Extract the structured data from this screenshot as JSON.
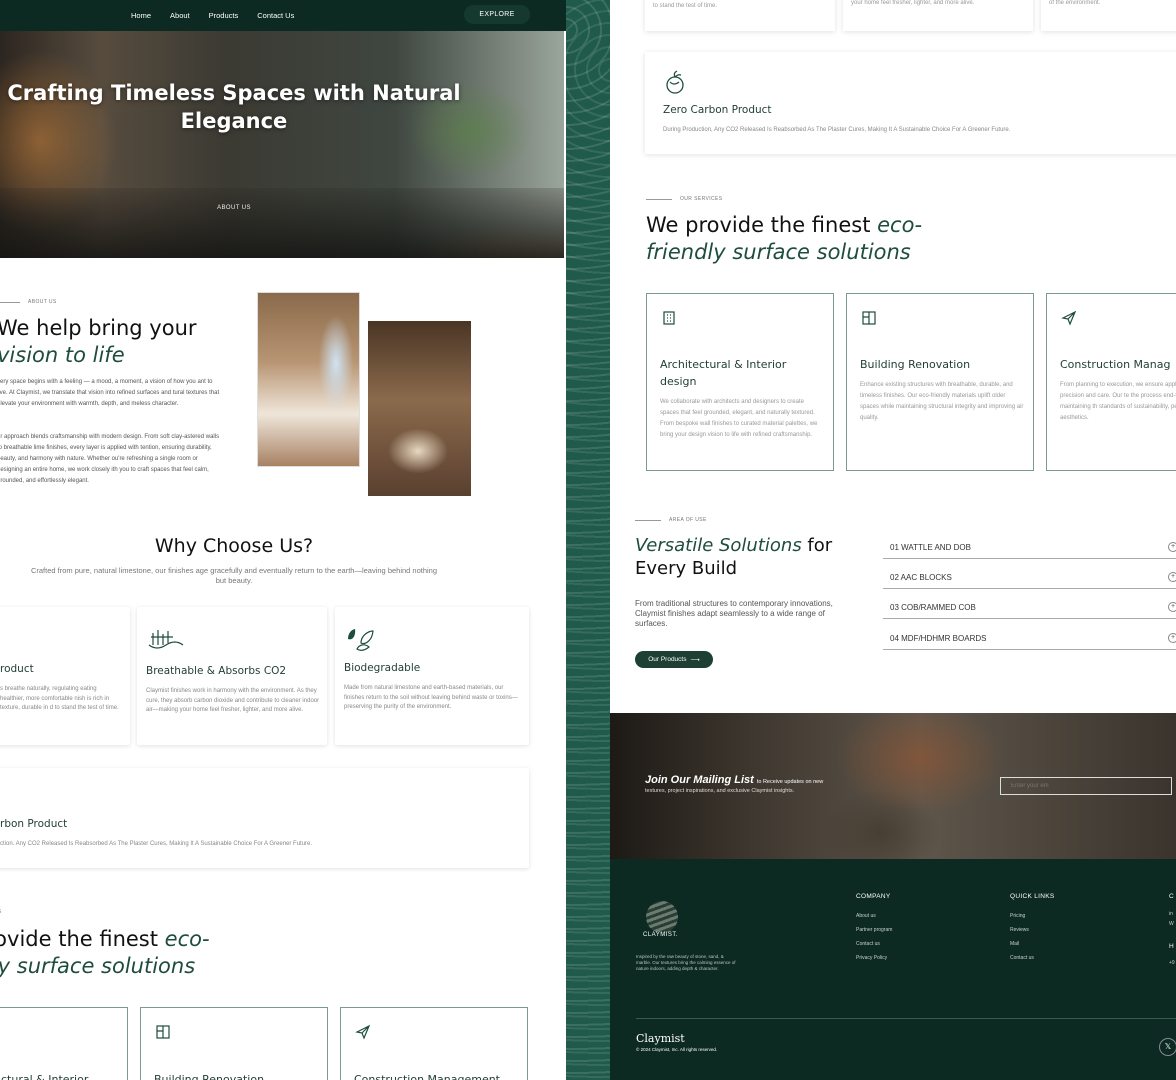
{
  "nav": {
    "links": [
      "Home",
      "About",
      "Products",
      "Contact Us"
    ],
    "explore": "EXPLORE"
  },
  "hero": {
    "title": "Crafting Timeless Spaces with Natural Elegance",
    "about_link": "ABOUT US"
  },
  "about": {
    "eyebrow": "ABOUT US",
    "title_plain": "We help bring your",
    "title_accent": "vision to life",
    "p1": "very space begins with a feeling — a mood, a moment, a vision of how you ant to live. At Claymist, we translate that vision into refined surfaces and tural textures that elevate your environment with warmth, depth, and meless character.",
    "p2": "ur approach blends craftsmanship with modern design. From soft clay-astered walls to breathable lime finishes, every layer is applied with tention, ensuring durability, beauty, and harmony with nature. Whether ou're refreshing a single room or designing an entire home, we work closely ith you to craft spaces that feel calm, grounded, and effortlessly elegant."
  },
  "why": {
    "title": "Why Choose Us?",
    "subtitle": "Crafted from pure, natural limestone, our finishes age gracefully and eventually return to the earth—leaving behind nothing but beauty.",
    "cards": [
      {
        "title": "roduct",
        "text": "s breathe naturally, regulating eating healthier, more comfortable nish is rich in texture, durable in d to stand the test of time."
      },
      {
        "title": "Breathable & Absorbs CO2",
        "text": "Claymist finishes work in harmony with the environment. As they cure, they absorb carbon dioxide and contribute to cleaner indoor air—making your home feel fresher, lighter, and more alive."
      },
      {
        "title": "Biodegradable",
        "text": "Made from natural limestone and earth-based materials, our finishes return to the soil without leaving behind waste or toxins—preserving the purity of the environment."
      }
    ],
    "zero_left": {
      "title": "rbon Product",
      "text": "ction. Any CO2 Released Is Reabsorbed As The Plaster Cures, Making It A Sustainable Choice For A Greener Future."
    }
  },
  "services_left": {
    "eyebrow": "ES",
    "title_plain": "rovide the finest",
    "title_accent1": "eco-",
    "title_accent2": "lly surface solutions",
    "cards": [
      "ctural & Interior",
      "Building Renovation",
      "Construction Management"
    ]
  },
  "right": {
    "top_texts": [
      "interiors. Each finish is rich in texture, durable in form, and crafted to stand the test of time.",
      "your home feel fresher, lighter, and more alive.",
      "of the environment."
    ],
    "zero": {
      "title": "Zero Carbon Product",
      "text": "During Production, Any CO2 Released Is Reabsorbed As The Plaster Cures, Making It A Sustainable Choice For A Greener Future."
    },
    "services": {
      "eyebrow": "OUR SERVICES",
      "title_plain": "We provide the finest",
      "title_accent1": "eco-",
      "title_accent2": "friendly surface solutions",
      "cards": [
        {
          "title": "Architectural & Interior design",
          "text": "We collaborate with architects and designers to create spaces that feel grounded, elegant, and naturally textured. From bespoke wall finishes to curated material palettes, we bring your design vision to life with refined craftsmanship."
        },
        {
          "title": "Building Renovation",
          "text": "Enhance existing structures with breathable, durable, and timeless finishes. Our eco-friendly materials uplift older spaces while maintaining structural integrity and improving air quality."
        },
        {
          "title": "Construction Manag",
          "text": "From planning to execution, we ensure applied with precision and care. Our te the process end-to-end, maintaining th standards of sustainability, performance aesthetics."
        }
      ]
    },
    "area": {
      "eyebrow": "AREA OF USE",
      "title_accent": "Versatile Solutions",
      "title_rest1": " for",
      "title_rest2": "Every Build",
      "text": "From traditional structures to contemporary innovations, Claymist finishes adapt seamlessly to a wide range of surfaces.",
      "button": "Our Products",
      "items": [
        "01 WATTLE AND DOB",
        "02 AAC BLOCKS",
        "03 COB/RAMMED COB",
        "04 MDF/HDHMR BOARDS"
      ]
    },
    "mailing": {
      "heading": "Join Our Mailing List",
      "heading_small": "to Receive updates on new",
      "sub": "textures, project inspirations, and exclusive Claymist insights.",
      "placeholder": "Enter your em"
    },
    "footer": {
      "brand": "CLAYMIST.",
      "desc": "Inspired by the raw beauty of stone, sand, & marble. Our textures bring the calming essence of nature indoors, adding depth & character.",
      "company_title": "COMPANY",
      "company_links": [
        "About us",
        "Partner program",
        "Contact us",
        "Privacy Policy"
      ],
      "quick_title": "QUICK LINKS",
      "quick_links": [
        "Pricing",
        "Reviews",
        "Mail",
        "Contact us"
      ],
      "col3_title": "C",
      "col3_lines": [
        "in",
        "W"
      ],
      "col3_sub": "H",
      "col3_phone": "+9",
      "script": "Claymist",
      "copyright": "© 2024 Claymist, Inc. All rights reserved.",
      "x_icon": "𝕏"
    }
  }
}
